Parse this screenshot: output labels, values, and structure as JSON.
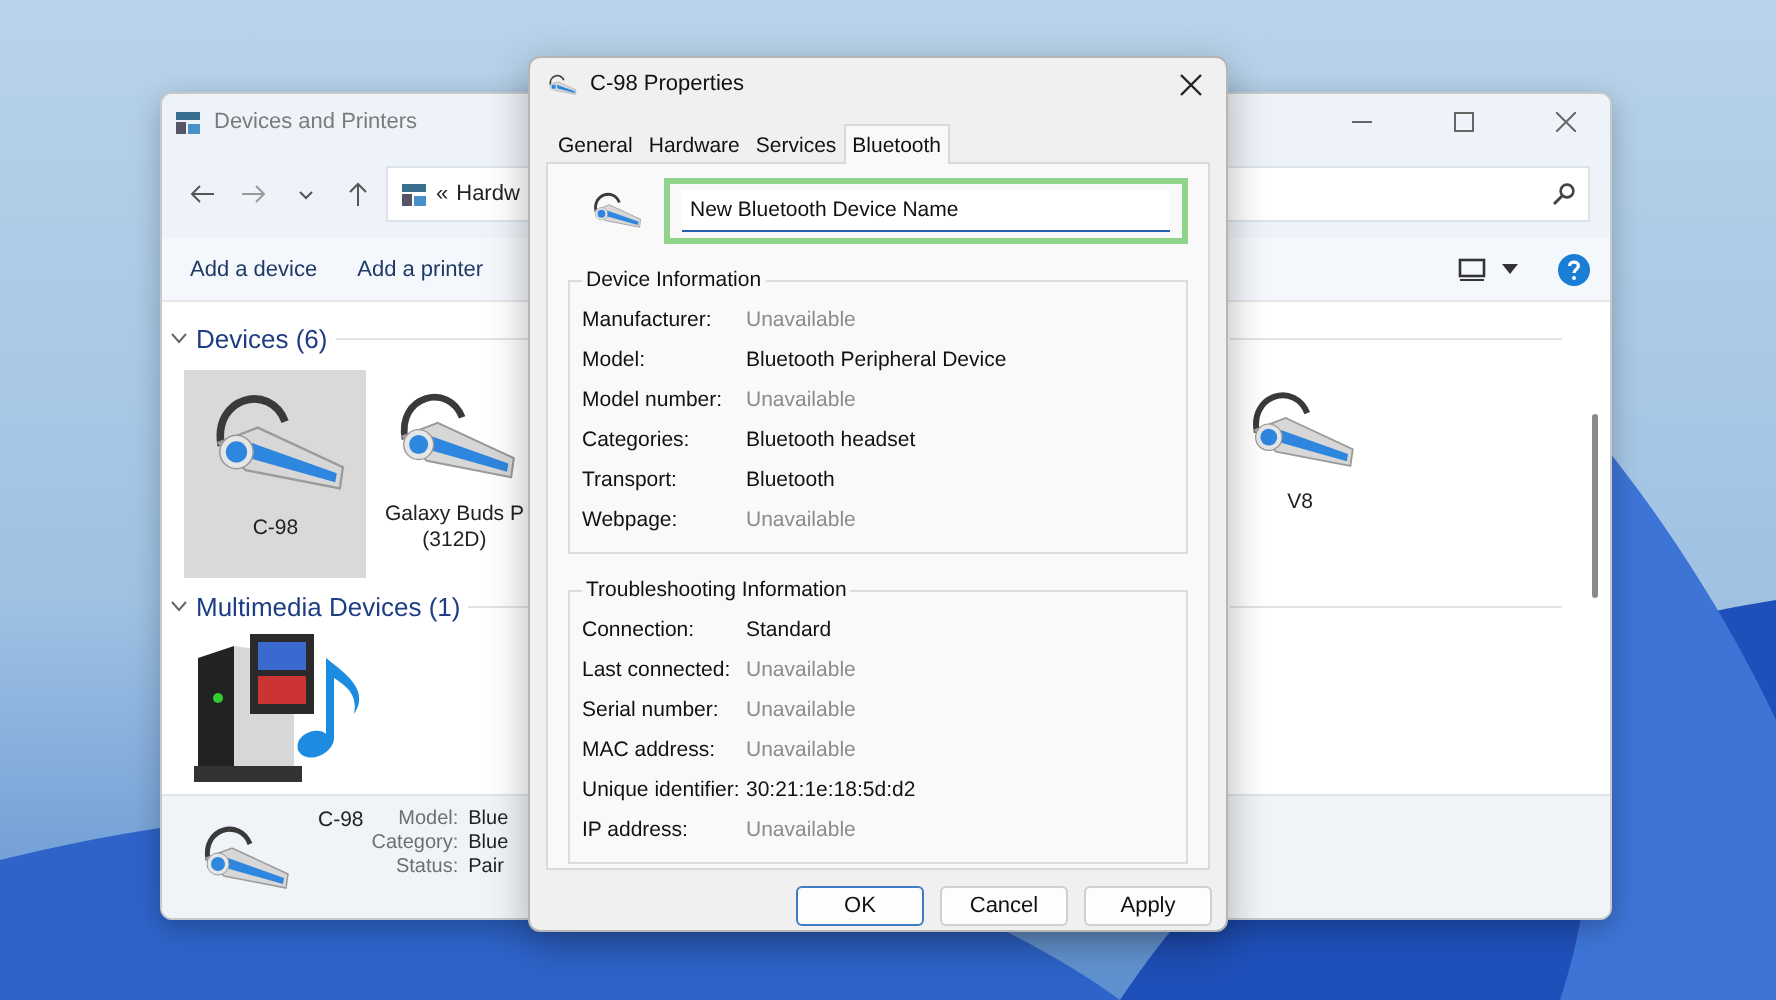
{
  "background_window": {
    "title": "Devices and Printers",
    "address_separator": "«",
    "address": "Hardw",
    "commands": [
      "Add a device",
      "Add a printer"
    ],
    "device_group": {
      "title": "Devices (6)",
      "expanded": true,
      "left_items": [
        {
          "label": "C-98",
          "selected": true
        },
        {
          "label": "Galaxy Buds P\n(312D)",
          "selected": false
        }
      ],
      "right_items": [
        {
          "label": "V8",
          "selected": false
        }
      ]
    },
    "multimedia_group": {
      "title": "Multimedia Devices (1)",
      "expanded": true
    },
    "details": {
      "name": "C-98",
      "fields": [
        {
          "label": "Model:",
          "value": "Blue"
        },
        {
          "label": "Category:",
          "value": "Blue"
        },
        {
          "label": "Status:",
          "value": "Pair"
        }
      ]
    }
  },
  "dialog": {
    "title": "C-98 Properties",
    "tabs": [
      {
        "label": "General",
        "selected": false
      },
      {
        "label": "Hardware",
        "selected": false
      },
      {
        "label": "Services",
        "selected": false
      },
      {
        "label": "Bluetooth",
        "selected": true
      }
    ],
    "name_field": {
      "value": "New Bluetooth Device Name",
      "highlighted": true
    },
    "sections": [
      {
        "title": "Device Information",
        "rows": [
          {
            "label": "Manufacturer:",
            "value": "Unavailable",
            "greyed": true
          },
          {
            "label": "Model:",
            "value": "Bluetooth Peripheral Device",
            "greyed": false
          },
          {
            "label": "Model number:",
            "value": "Unavailable",
            "greyed": true
          },
          {
            "label": "Categories:",
            "value": "Bluetooth headset",
            "greyed": false
          },
          {
            "label": "Transport:",
            "value": "Bluetooth",
            "greyed": false
          },
          {
            "label": "Webpage:",
            "value": "Unavailable",
            "greyed": true
          }
        ]
      },
      {
        "title": "Troubleshooting Information",
        "rows": [
          {
            "label": "Connection:",
            "value": "Standard",
            "greyed": false
          },
          {
            "label": "Last connected:",
            "value": "Unavailable",
            "greyed": true
          },
          {
            "label": "Serial number:",
            "value": "Unavailable",
            "greyed": true
          },
          {
            "label": "MAC address:",
            "value": "Unavailable",
            "greyed": true
          },
          {
            "label": "Unique identifier:",
            "value": "30:21:1e:18:5d:d2",
            "greyed": false
          },
          {
            "label": "IP address:",
            "value": "Unavailable",
            "greyed": true
          }
        ]
      }
    ],
    "buttons": [
      {
        "label": "OK",
        "default": true
      },
      {
        "label": "Cancel",
        "default": false
      },
      {
        "label": "Apply",
        "default": false
      }
    ]
  }
}
